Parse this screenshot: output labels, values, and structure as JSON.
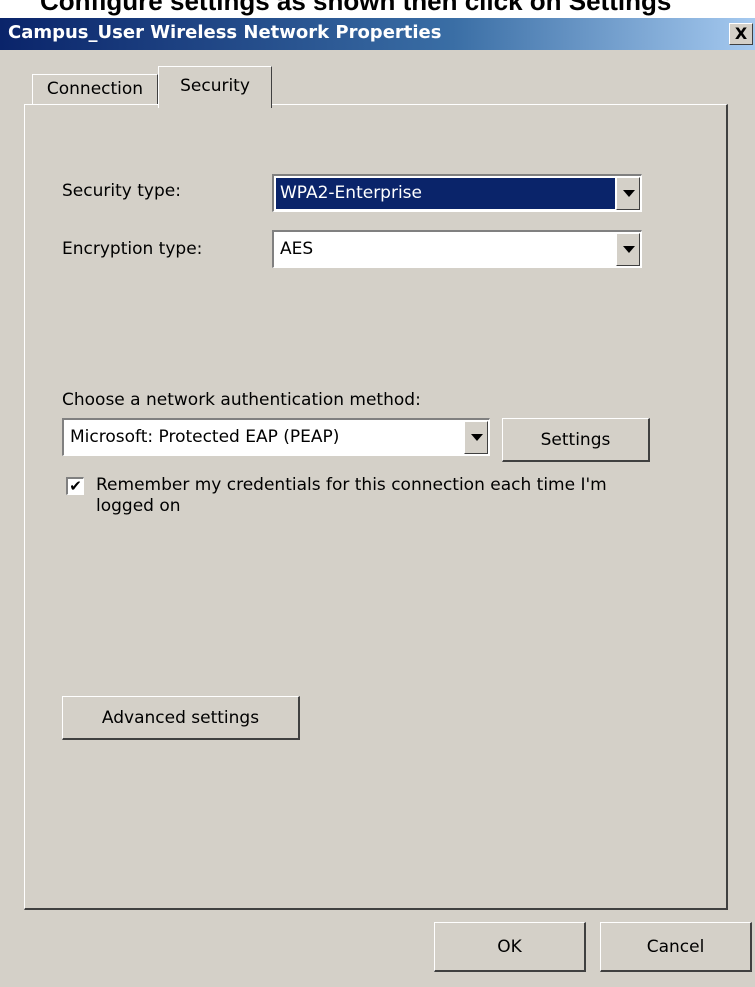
{
  "background_heading": "Configure settings as shown then click on Settings",
  "window": {
    "title": "Campus_User Wireless Network Properties",
    "close_glyph": "X"
  },
  "tabs": [
    {
      "label": "Connection",
      "active": false
    },
    {
      "label": "Security",
      "active": true
    }
  ],
  "security_type": {
    "label": "Security type:",
    "value": "WPA2-Enterprise"
  },
  "encryption_type": {
    "label": "Encryption type:",
    "value": "AES"
  },
  "auth_method": {
    "label": "Choose a network authentication method:",
    "value": "Microsoft: Protected EAP (PEAP)",
    "settings_button": "Settings"
  },
  "remember_credentials": {
    "checked": true,
    "check_glyph": "✔",
    "label": "Remember my credentials for this connection each time I'm logged on"
  },
  "advanced_settings_button": "Advanced settings",
  "footer": {
    "ok_label": "OK",
    "cancel_label": "Cancel"
  },
  "colors": {
    "dialog_face": "#d4d0c8",
    "titlebar_start": "#0a246a",
    "titlebar_end": "#a6caf0",
    "selection": "#0a246a"
  }
}
